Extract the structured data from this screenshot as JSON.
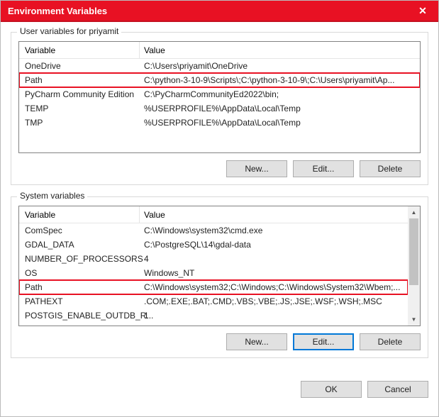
{
  "titlebar": {
    "title": "Environment Variables"
  },
  "user_group": {
    "label": "User variables for priyamit",
    "headers": {
      "var": "Variable",
      "val": "Value"
    },
    "rows": [
      {
        "var": "OneDrive",
        "val": "C:\\Users\\priyamit\\OneDrive",
        "highlight": false
      },
      {
        "var": "Path",
        "val": "C:\\python-3-10-9\\Scripts\\;C:\\python-3-10-9\\;C:\\Users\\priyamit\\Ap...",
        "highlight": true
      },
      {
        "var": "PyCharm Community Edition",
        "val": "C:\\PyCharmCommunityEd2022\\bin;",
        "highlight": false
      },
      {
        "var": "TEMP",
        "val": "%USERPROFILE%\\AppData\\Local\\Temp",
        "highlight": false
      },
      {
        "var": "TMP",
        "val": "%USERPROFILE%\\AppData\\Local\\Temp",
        "highlight": false
      }
    ],
    "buttons": {
      "new": "New...",
      "edit": "Edit...",
      "delete": "Delete"
    }
  },
  "system_group": {
    "label": "System variables",
    "headers": {
      "var": "Variable",
      "val": "Value"
    },
    "rows": [
      {
        "var": "ComSpec",
        "val": "C:\\Windows\\system32\\cmd.exe",
        "highlight": false
      },
      {
        "var": "GDAL_DATA",
        "val": "C:\\PostgreSQL\\14\\gdal-data",
        "highlight": false
      },
      {
        "var": "NUMBER_OF_PROCESSORS",
        "val": "4",
        "highlight": false
      },
      {
        "var": "OS",
        "val": "Windows_NT",
        "highlight": false
      },
      {
        "var": "Path",
        "val": "C:\\Windows\\system32;C:\\Windows;C:\\Windows\\System32\\Wbem;...",
        "highlight": true
      },
      {
        "var": "PATHEXT",
        "val": ".COM;.EXE;.BAT;.CMD;.VBS;.VBE;.JS;.JSE;.WSF;.WSH;.MSC",
        "highlight": false
      },
      {
        "var": "POSTGIS_ENABLE_OUTDB_R...",
        "val": "1",
        "highlight": false
      }
    ],
    "buttons": {
      "new": "New...",
      "edit": "Edit...",
      "delete": "Delete"
    }
  },
  "dialog_buttons": {
    "ok": "OK",
    "cancel": "Cancel"
  }
}
